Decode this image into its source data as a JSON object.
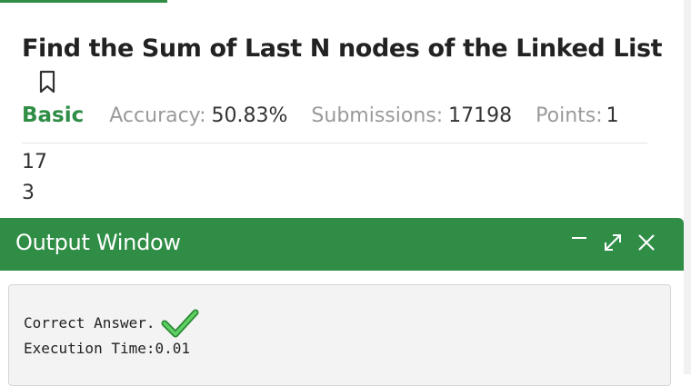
{
  "problem": {
    "title": "Find the Sum of Last N nodes of the Linked List",
    "difficulty": "Basic",
    "accuracy_label": "Accuracy:",
    "accuracy_value": "50.83%",
    "submissions_label": "Submissions:",
    "submissions_value": "17198",
    "points_label": "Points:",
    "points_value": "1"
  },
  "input": {
    "lines": [
      "17",
      "3"
    ]
  },
  "output_window": {
    "title": "Output Window",
    "result_text": "Correct Answer.",
    "execution_time": "Execution Time:0.01"
  },
  "icons": {
    "bookmark": "bookmark-icon",
    "minimize": "minimize-icon",
    "expand": "expand-icon",
    "close": "close-icon",
    "check": "check-icon"
  },
  "colors": {
    "brand_green": "#2f8d46",
    "check_green": "#3cb043"
  }
}
